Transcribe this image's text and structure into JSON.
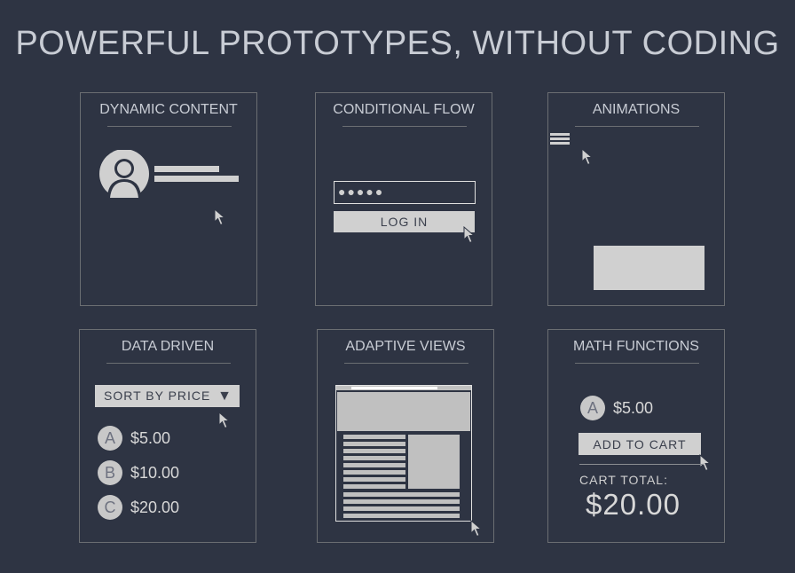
{
  "headline": "POWERFUL PROTOTYPES, WITHOUT CODING",
  "panels": {
    "dynamic": {
      "title": "DYNAMIC CONTENT"
    },
    "conditional": {
      "title": "CONDITIONAL FLOW",
      "password_mask": "●●●●●",
      "button": "LOG IN"
    },
    "animations": {
      "title": "ANIMATIONS"
    },
    "data": {
      "title": "DATA DRIVEN",
      "dropdown": "SORT BY PRICE",
      "items": [
        {
          "letter": "A",
          "price": "$5.00"
        },
        {
          "letter": "B",
          "price": "$10.00"
        },
        {
          "letter": "C",
          "price": "$20.00"
        }
      ]
    },
    "adaptive": {
      "title": "ADAPTIVE VIEWS"
    },
    "math": {
      "title": "MATH FUNCTIONS",
      "item": {
        "letter": "A",
        "price": "$5.00"
      },
      "button": "ADD TO CART",
      "total_label": "CART TOTAL:",
      "total": "$20.00"
    }
  }
}
